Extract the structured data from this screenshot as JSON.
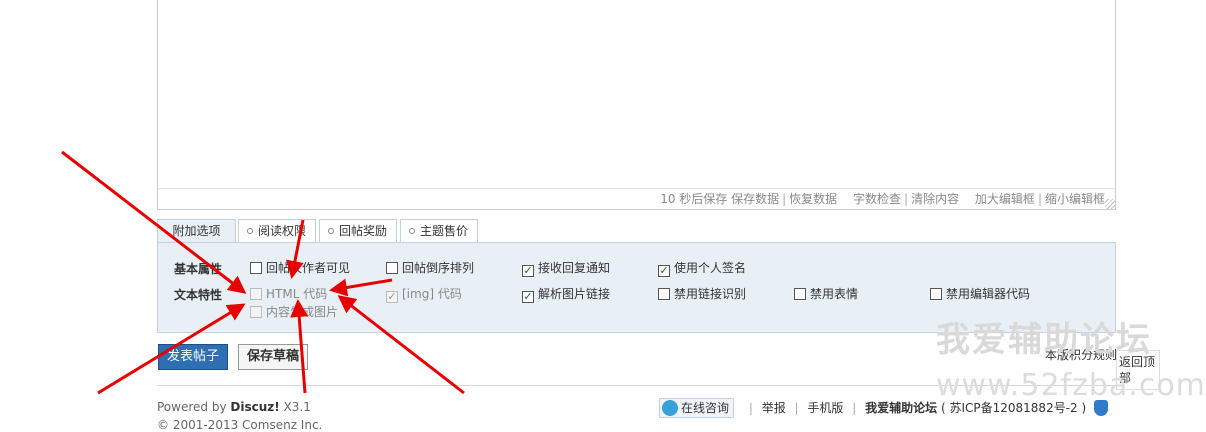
{
  "editor": {
    "status": {
      "autosave": "10 秒后保存",
      "save_data": "保存数据",
      "restore_data": "恢复数据",
      "word_check": "字数检查",
      "clear_content": "清除内容",
      "enlarge": "加大编辑框",
      "shrink": "缩小编辑框"
    }
  },
  "tabs": [
    {
      "label": "附加选项",
      "active": true
    },
    {
      "label": "阅读权限"
    },
    {
      "label": "回帖奖励"
    },
    {
      "label": "主题售价"
    }
  ],
  "options": {
    "basic_label": "基本属性",
    "text_label": "文本特性",
    "basic": [
      {
        "label": "回帖仅作者可见",
        "checked": false
      },
      {
        "label": "回帖倒序排列",
        "checked": false
      },
      {
        "label": "接收回复通知",
        "checked": true
      },
      {
        "label": "使用个人签名",
        "checked": true
      }
    ],
    "text": [
      {
        "label": "HTML 代码",
        "checked": false,
        "disabled": true
      },
      {
        "label": "[img] 代码",
        "checked": true,
        "disabled": true
      },
      {
        "label": "解析图片链接",
        "checked": true
      },
      {
        "label": "禁用链接识别",
        "checked": false
      },
      {
        "label": "禁用表情",
        "checked": false
      },
      {
        "label": "禁用编辑器代码",
        "checked": false
      },
      {
        "label": "内容生成图片",
        "checked": false,
        "disabled": true
      }
    ]
  },
  "actions": {
    "post": "发表帖子",
    "draft": "保存草稿",
    "rules": "本版积分规则",
    "back_top": "返回顶部"
  },
  "footer": {
    "powered_prefix": "Powered by ",
    "powered_brand": "Discuz!",
    "powered_version": " X3.1",
    "copyright": "© 2001-2013 Comsenz Inc.",
    "consult": "在线咨询",
    "report": "举报",
    "mobile": "手机版",
    "site": "我爱辅助论坛",
    "icp": "( 苏ICP备12081882号-2 )"
  },
  "watermark": {
    "title": "我爱辅助论坛",
    "url": "www.52fzba.com"
  },
  "colors": {
    "panel_bg": "#e8eff5",
    "post_button": "#2f6eb0",
    "arrow": "#e60000"
  }
}
